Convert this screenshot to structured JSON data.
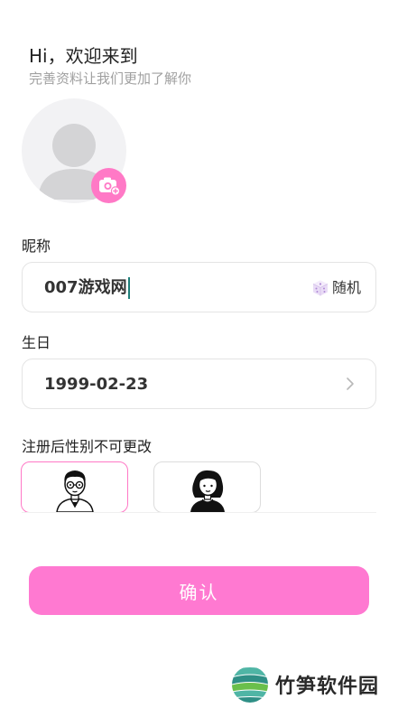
{
  "header": {
    "greeting": "Hi，欢迎来到",
    "subtitle": "完善资料让我们更加了解你"
  },
  "avatar": {
    "icon": "default-avatar-icon",
    "badge_icon": "camera-add-icon",
    "badge_color": "#ff79c6"
  },
  "nickname": {
    "label": "昵称",
    "value": "007游戏网",
    "random_label": "随机",
    "random_icon": "dice-icon"
  },
  "birthday": {
    "label": "生日",
    "value": "1999-02-23",
    "chevron_icon": "chevron-right-icon"
  },
  "gender": {
    "label": "注册后性别不可更改",
    "options": [
      {
        "id": "male",
        "icon": "male-avatar-icon",
        "selected": true
      },
      {
        "id": "female",
        "icon": "female-avatar-icon",
        "selected": false
      }
    ],
    "selected_color": "#ff79c6"
  },
  "confirm": {
    "label": "确认",
    "color": "#ff79d1"
  },
  "watermark": {
    "text": "竹笋软件园",
    "icon": "bamboo-logo-icon"
  }
}
